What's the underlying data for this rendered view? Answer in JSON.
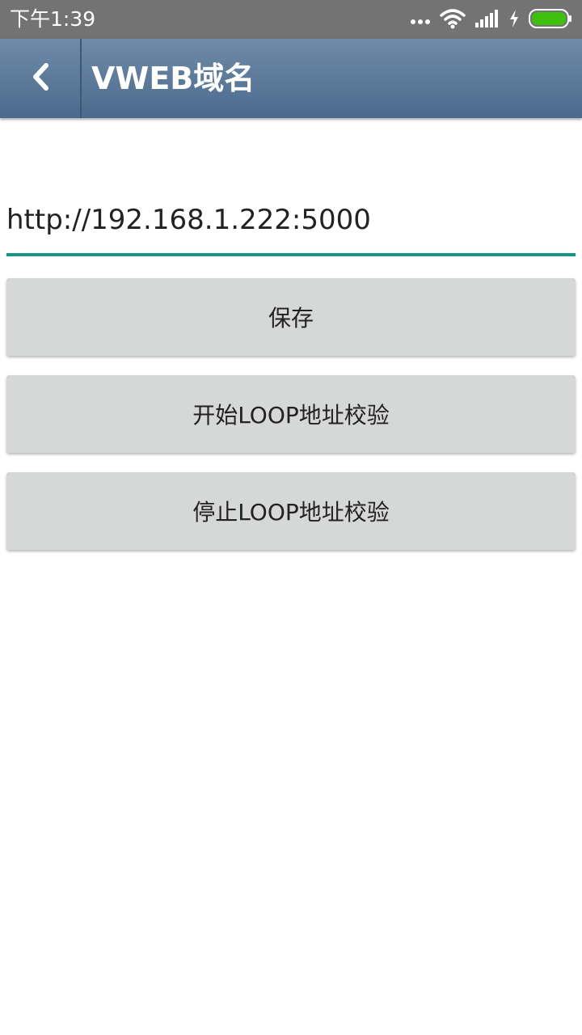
{
  "status_bar": {
    "time": "下午1:39",
    "icons": [
      "more-dots-icon",
      "wifi-icon",
      "signal-icon",
      "charging-icon",
      "battery-icon"
    ],
    "battery_color": "#3fc00f"
  },
  "app_bar": {
    "title": "VWEB域名",
    "back_icon": "chevron-left-icon",
    "colors": {
      "top": "#6e8ba8",
      "bottom": "#4c6a8d"
    }
  },
  "form": {
    "url_value": "http://192.168.1.222:5000",
    "underline_color": "#169688"
  },
  "buttons": {
    "save_label": "保存",
    "start_label": "开始LOOP地址校验",
    "stop_label": "停止LOOP地址校验"
  }
}
